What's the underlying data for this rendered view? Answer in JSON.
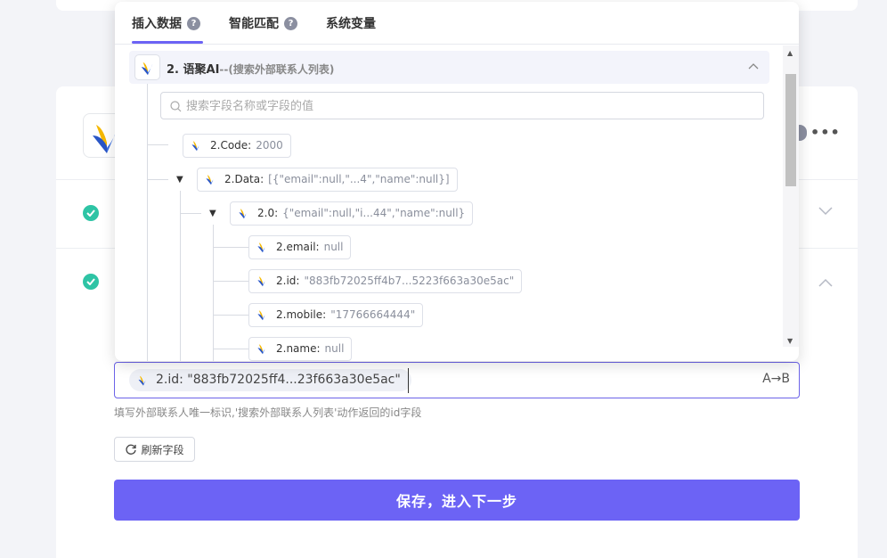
{
  "popup": {
    "tabs": [
      {
        "label": "插入数据",
        "help": "?"
      },
      {
        "label": "智能匹配",
        "help": "?"
      },
      {
        "label": "系统变量"
      }
    ],
    "source": {
      "title": "2. 语聚AI",
      "subtitle": "--(搜索外部联系人列表)"
    },
    "search": {
      "placeholder": "搜索字段名称或字段的值"
    },
    "nodes": [
      {
        "key": "2.Code:",
        "value": "2000"
      },
      {
        "key": "2.Data:",
        "value": "[{\"email\":null,\"...4\",\"name\":null}]"
      },
      {
        "key": "2.0:",
        "value": "{\"email\":null,\"i...44\",\"name\":null}"
      },
      {
        "key": "2.email:",
        "value": "null"
      },
      {
        "key": "2.id:",
        "value": "\"883fb72025ff4b7...5223f663a30e5ac\""
      },
      {
        "key": "2.mobile:",
        "value": "\"17766664444\""
      },
      {
        "key": "2.name:",
        "value": "null"
      }
    ]
  },
  "field": {
    "tag_label": "2.id: \"883fb72025ff4...23f663a30e5ac\"",
    "ab_label": "A→B",
    "hint": "填写外部联系人唯一标识,'搜索外部联系人列表'动作返回的id字段"
  },
  "refresh_label": "刷新字段",
  "save_label": "保存，进入下一步",
  "colors": {
    "accent": "#6c63f5",
    "success": "#2ec4a5"
  },
  "icons": {
    "logo": "yujuai-logo-icon",
    "search": "search-icon",
    "refresh": "refresh-icon"
  }
}
